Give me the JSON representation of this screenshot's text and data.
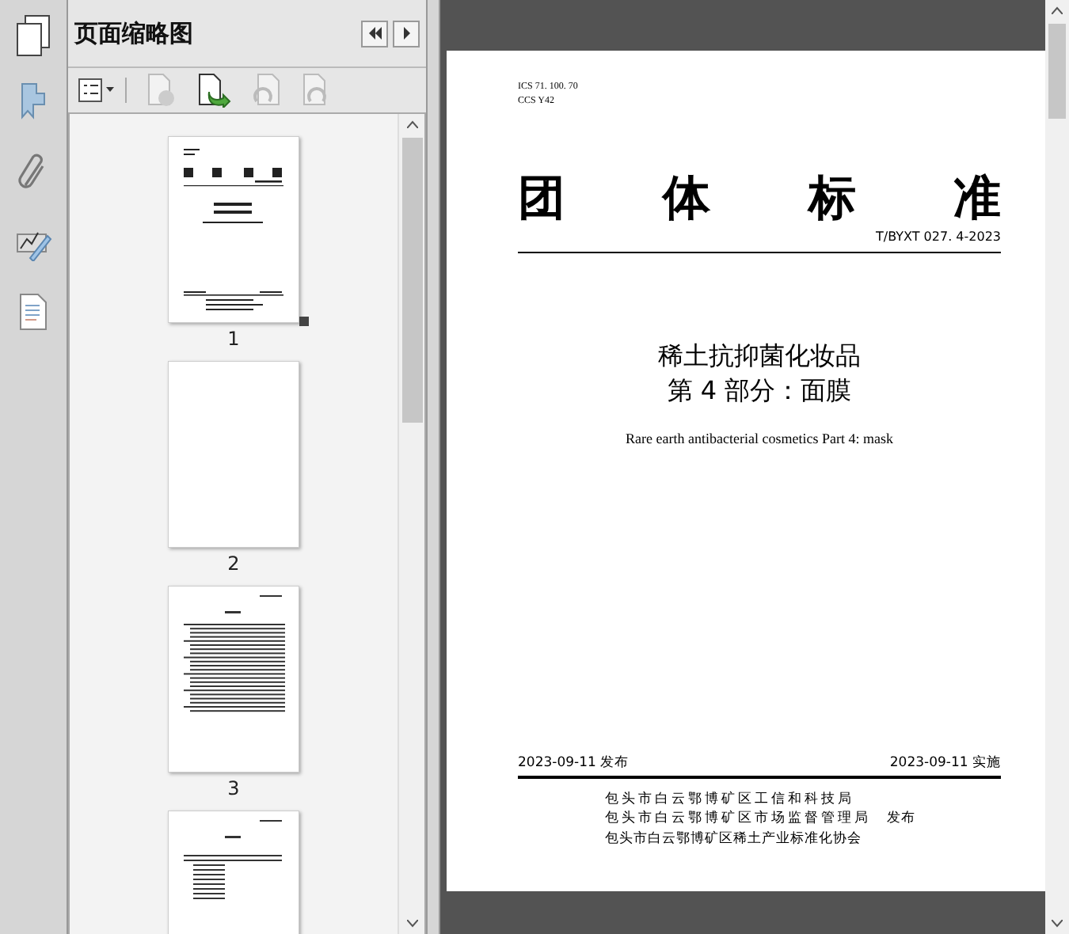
{
  "panel": {
    "title": "页面缩略图",
    "thumbnails": [
      {
        "label": "1",
        "kind": "cover",
        "current": true
      },
      {
        "label": "2",
        "kind": "blank",
        "current": false
      },
      {
        "label": "3",
        "kind": "toc",
        "current": false
      },
      {
        "kind": "text"
      }
    ]
  },
  "document": {
    "ics": "ICS 71. 100. 70",
    "ccs": "CCS Y42",
    "heading": "团体标准",
    "code": "T/BYXT 027. 4-2023",
    "title_lines": [
      "稀土抗抑菌化妆品",
      "第 4 部分：面膜"
    ],
    "english_title": "Rare earth antibacterial cosmetics Part 4: mask",
    "published": "2023-09-11 发布",
    "effective": "2023-09-11 实施",
    "issuers": [
      "包头市白云鄂博矿区工信和科技局",
      "包头市白云鄂博矿区市场监督管理局",
      "包头市白云鄂博矿区稀土产业标准化协会"
    ],
    "issue_word": "发布"
  }
}
